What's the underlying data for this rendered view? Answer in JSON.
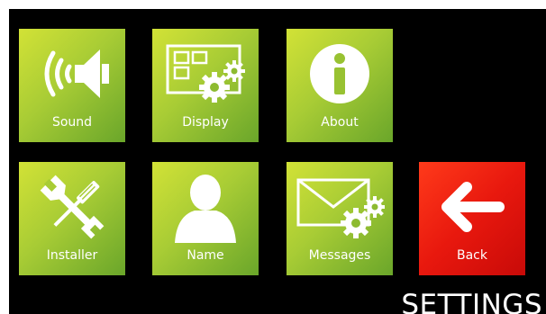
{
  "screen": {
    "title": "SETTINGS",
    "background_color": "#000000"
  },
  "tiles": [
    {
      "label": "Sound",
      "icon": "speaker-icon"
    },
    {
      "label": "Display",
      "icon": "display-gears-icon"
    },
    {
      "label": "About",
      "icon": "info-icon"
    },
    {
      "label": "Installer",
      "icon": "tools-icon"
    },
    {
      "label": "Name",
      "icon": "user-icon"
    },
    {
      "label": "Messages",
      "icon": "envelope-gears-icon"
    },
    {
      "label": "Back",
      "icon": "arrow-left-icon"
    }
  ],
  "colors": {
    "tile_green": "#a8cc35",
    "tile_red": "#e8180e",
    "text": "#ffffff"
  }
}
